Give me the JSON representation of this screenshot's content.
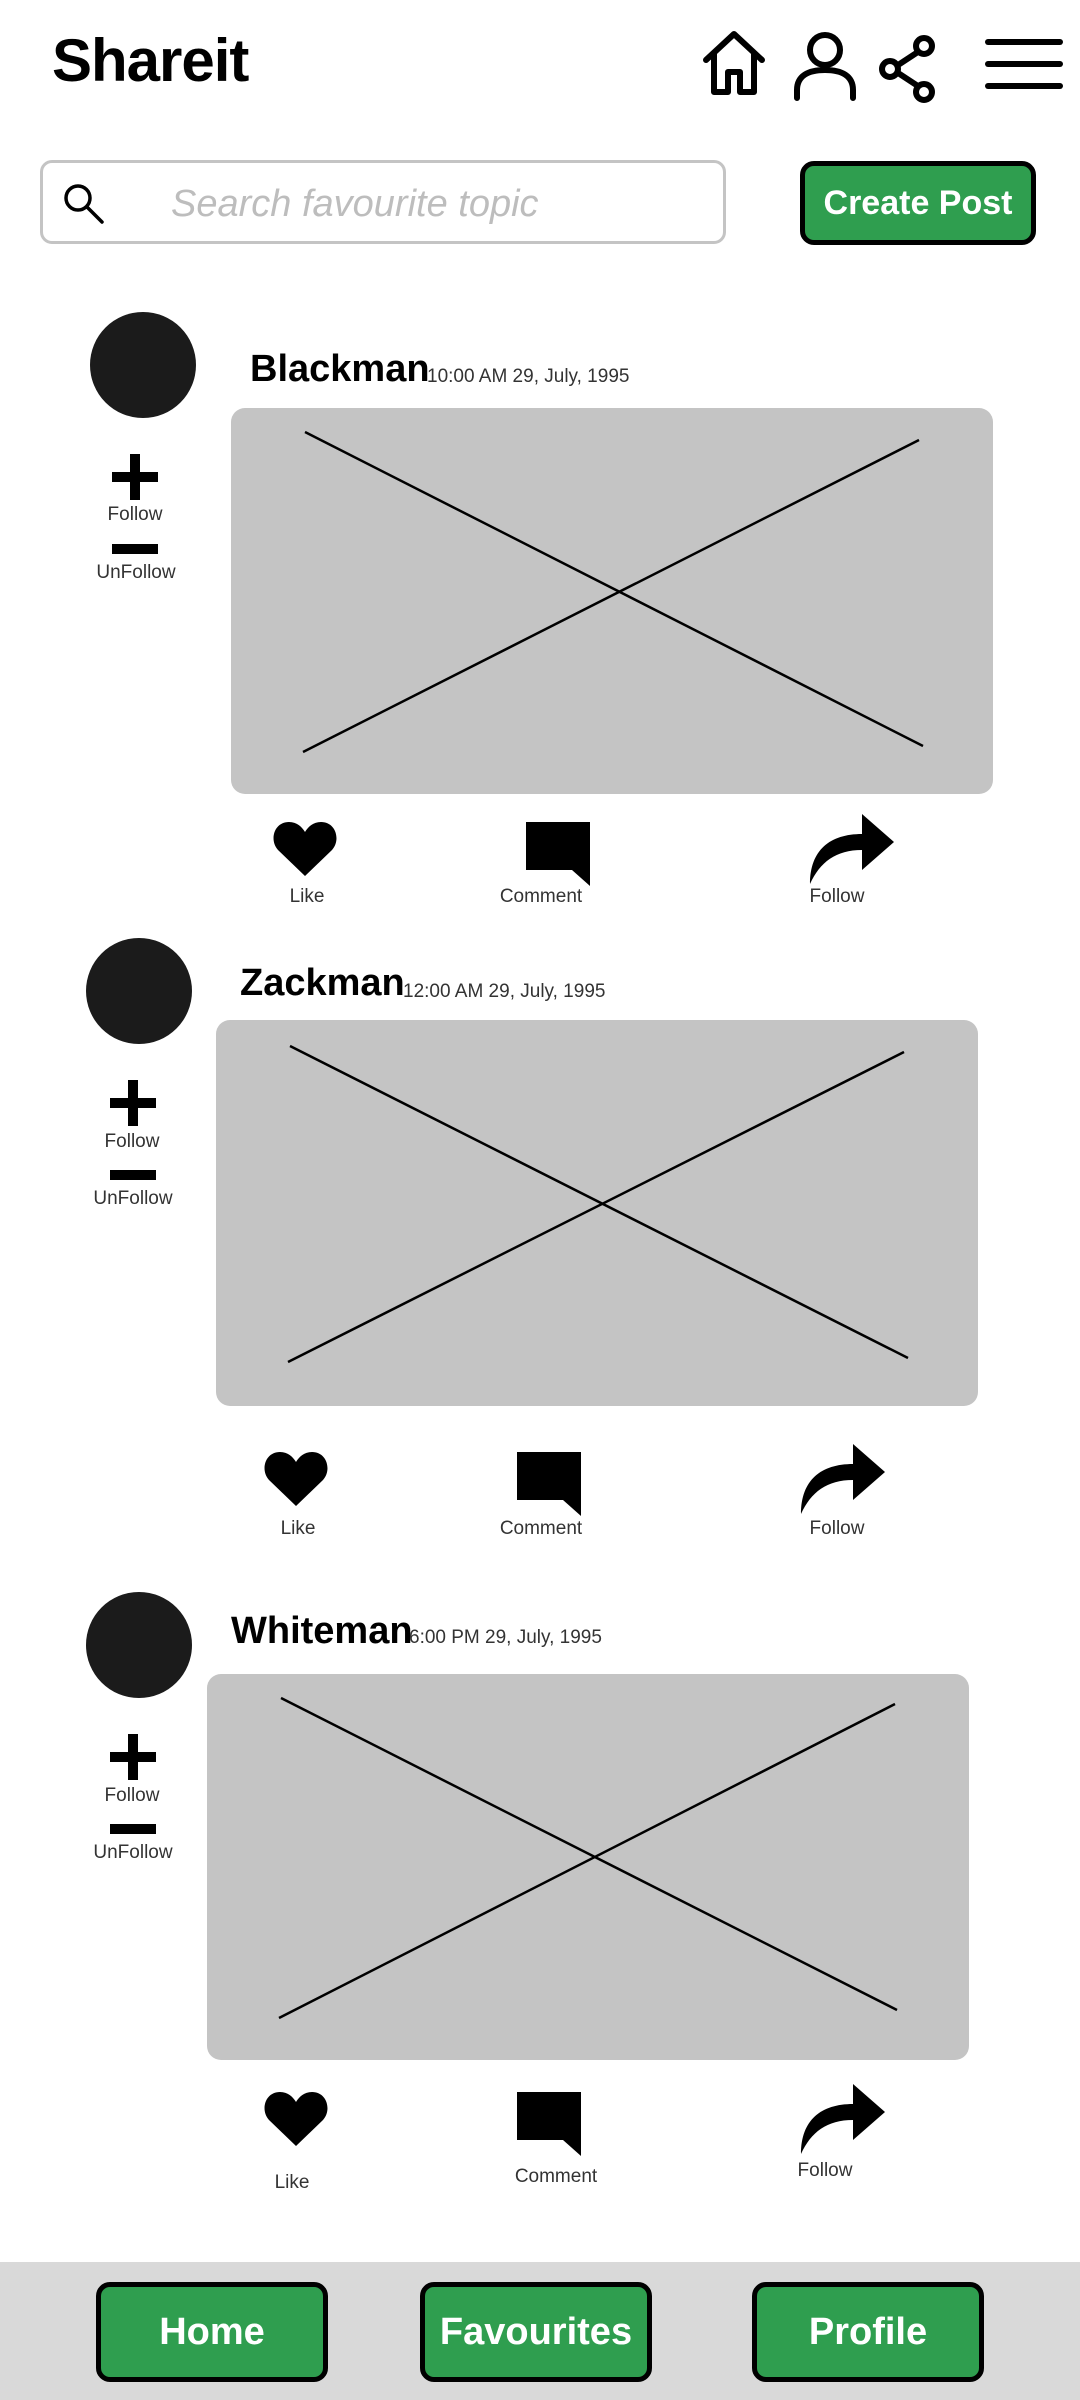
{
  "header": {
    "title": "Shareit",
    "icons": [
      "home-icon",
      "user-icon",
      "share-icon",
      "menu-icon"
    ]
  },
  "search": {
    "placeholder": "Search favourite topic",
    "value": ""
  },
  "create_post_label": "Create Post",
  "colors": {
    "accent": "#2f9e4f",
    "image_placeholder": "#c4c4c4",
    "avatar": "#1b1b1b",
    "bottom_bar": "#d9d9d9"
  },
  "posts": [
    {
      "user": "Blackman",
      "time": "10:00 AM 29, July, 1995",
      "follow_label": "Follow",
      "unfollow_label": "UnFollow",
      "like_label": "Like",
      "comment_label": "Comment",
      "share_label": "Follow"
    },
    {
      "user": "Zackman",
      "time": "12:00 AM 29, July, 1995",
      "follow_label": "Follow",
      "unfollow_label": "UnFollow",
      "like_label": "Like",
      "comment_label": "Comment",
      "share_label": "Follow"
    },
    {
      "user": "Whiteman",
      "time": "6:00 PM 29, July, 1995",
      "follow_label": "Follow",
      "unfollow_label": "UnFollow",
      "like_label": "Like",
      "comment_label": "Comment",
      "share_label": "Follow"
    }
  ],
  "bottom_nav": {
    "home": "Home",
    "favourites": "Favourites",
    "profile": "Profile"
  }
}
